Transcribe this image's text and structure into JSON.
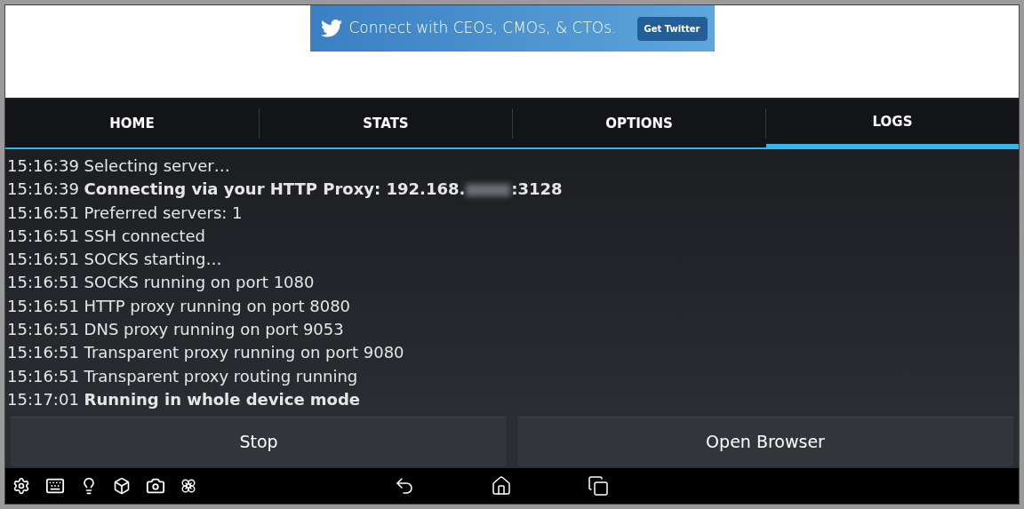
{
  "ad": {
    "text": "Connect with CEOs, CMOs, & CTOs.",
    "button": "Get Twitter"
  },
  "tabs": [
    {
      "label": "HOME",
      "selected": false
    },
    {
      "label": "STATS",
      "selected": false
    },
    {
      "label": "OPTIONS",
      "selected": false
    },
    {
      "label": "LOGS",
      "selected": true
    }
  ],
  "log": [
    {
      "time": "15:16:39",
      "text": "Selecting server…",
      "bold": false
    },
    {
      "time": "15:16:39",
      "text": "Connecting via your HTTP Proxy: 192.168.",
      "suffix": ":3128",
      "redacted": true,
      "bold": true
    },
    {
      "time": "15:16:51",
      "text": "Preferred servers: 1",
      "bold": false
    },
    {
      "time": "15:16:51",
      "text": "SSH connected",
      "bold": false
    },
    {
      "time": "15:16:51",
      "text": "SOCKS starting…",
      "bold": false
    },
    {
      "time": "15:16:51",
      "text": "SOCKS running on port 1080",
      "bold": false
    },
    {
      "time": "15:16:51",
      "text": "HTTP proxy running on port 8080",
      "bold": false
    },
    {
      "time": "15:16:51",
      "text": "DNS proxy running on port 9053",
      "bold": false
    },
    {
      "time": "15:16:51",
      "text": "Transparent proxy running on port 9080",
      "bold": false
    },
    {
      "time": "15:16:51",
      "text": "Transparent proxy routing running",
      "bold": false
    },
    {
      "time": "15:17:01",
      "text": "Running in whole device mode",
      "bold": true
    }
  ],
  "buttons": [
    "Stop",
    "Open Browser"
  ]
}
